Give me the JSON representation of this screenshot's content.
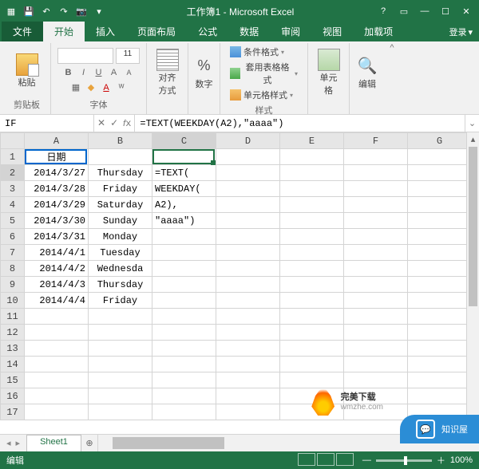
{
  "title": "工作簿1 - Microsoft Excel",
  "tabs": {
    "file": "文件",
    "home": "开始",
    "insert": "插入",
    "layout": "页面布局",
    "formulas": "公式",
    "data": "数据",
    "review": "审阅",
    "view": "视图",
    "addins": "加载项",
    "login": "登录"
  },
  "ribbon": {
    "paste": "粘贴",
    "clipboard": "剪贴板",
    "font": "字体",
    "align": "对齐方式",
    "number": "数字",
    "styles": "样式",
    "condfmt": "条件格式",
    "tablefmt": "套用表格格式",
    "cellstyle": "单元格样式",
    "cells": "单元格",
    "editing": "编辑",
    "fontname": "",
    "fontsize": "11"
  },
  "namebox": "IF",
  "formula": "=TEXT(WEEKDAY(A2),\"aaaa\")",
  "cols": [
    "A",
    "B",
    "C",
    "D",
    "E",
    "F",
    "G"
  ],
  "rows": [
    {
      "n": 1,
      "A": "日期",
      "Aclass": "hdr"
    },
    {
      "n": 2,
      "A": "2014/3/27",
      "B": "Thursday",
      "C": "=TEXT("
    },
    {
      "n": 3,
      "A": "2014/3/28",
      "B": "Friday",
      "C": "WEEKDAY("
    },
    {
      "n": 4,
      "A": "2014/3/29",
      "B": "Saturday",
      "C": "A2),"
    },
    {
      "n": 5,
      "A": "2014/3/30",
      "B": "Sunday",
      "C": "\"aaaa\")"
    },
    {
      "n": 6,
      "A": "2014/3/31",
      "B": "Monday"
    },
    {
      "n": 7,
      "A": "2014/4/1",
      "B": "Tuesday"
    },
    {
      "n": 8,
      "A": "2014/4/2",
      "B": "Wednesda"
    },
    {
      "n": 9,
      "A": "2014/4/3",
      "B": "Thursday"
    },
    {
      "n": 10,
      "A": "2014/4/4",
      "B": "Friday"
    },
    {
      "n": 11
    },
    {
      "n": 12
    },
    {
      "n": 13
    },
    {
      "n": 14
    },
    {
      "n": 15
    },
    {
      "n": 16
    },
    {
      "n": 17
    }
  ],
  "sheet": "Sheet1",
  "status": "编辑",
  "zoom": "100%",
  "wm1": {
    "title": "完美下载",
    "sub": "wmzhe.com"
  },
  "wm2": "知识屋"
}
